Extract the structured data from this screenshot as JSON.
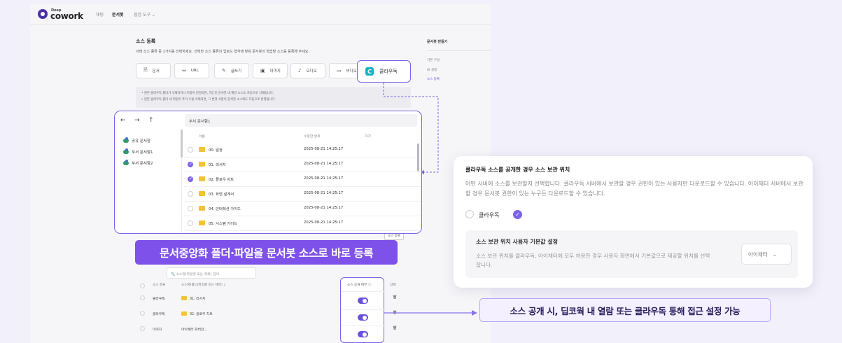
{
  "header": {
    "logo_small": "Deep",
    "logo_big": "cowork",
    "nav": [
      "채팅",
      "문서봇",
      "협업 도구 ⌄"
    ]
  },
  "main": {
    "title": "소스 등록",
    "description": "아래 소스 종류 중 1가지를 선택하세요. 선택한 소스 종류의 업로드 형식에 맞춰 문서봇의 학습할 소스를 등록해 주세요.",
    "source_types": [
      {
        "icon": "🗎",
        "label": "문서"
      },
      {
        "icon": "⇔",
        "label": "URL"
      },
      {
        "icon": "✎",
        "label": "글쓰기"
      },
      {
        "icon": "▣",
        "label": "이미지"
      },
      {
        "icon": "♪",
        "label": "오디오"
      },
      {
        "icon": "▭",
        "label": "비디오"
      }
    ],
    "notes": [
      "• 원본 클라우독 폴더가 삭제되거나 이름이 변경되면, 7일 후 문서봇 내 해당 소스도 자동으로 삭제됩니다.",
      "• 원본 클라우독 폴더 내 파일이 추가·수정·삭제되면, 그 변경 사항이 문서봇 소스에도 자동으로 반영됩니다."
    ]
  },
  "right_panel": {
    "title": "문서봇 만들기",
    "items": [
      "기본 구성",
      "AI 설정",
      "소스 등록"
    ]
  },
  "clipper_callout": {
    "logo_letter": "C",
    "label": "클라우독"
  },
  "file_picker": {
    "path": "부서 문서함1",
    "sidebar": [
      "공유 문서함",
      "부서 문서함1",
      "부서 문서함2"
    ],
    "columns": [
      "이름",
      "수정한 날짜",
      "크기"
    ],
    "rows": [
      {
        "name": "00. 일정",
        "date": "2025-08-21 14:25:17",
        "checked": false
      },
      {
        "name": "01. 리서치",
        "date": "2025-08-21 14:25:17",
        "checked": true
      },
      {
        "name": "02. 플로우 차트",
        "date": "2025-08-21 14:25:17",
        "checked": true
      },
      {
        "name": "03. 화면 설계서",
        "date": "2025-08-21 14:25:17",
        "checked": false
      },
      {
        "name": "04. 인터렉션 가이드",
        "date": "2025-08-21 14:25:17",
        "checked": false
      },
      {
        "name": "05. 시스템 가이드",
        "date": "2025-08-21 14:25:17",
        "checked": false
      }
    ]
  },
  "banner_text": "문서중앙화 폴더·파일을 문서봇 소스로 바로 등록",
  "source_register_button": "소스 등록",
  "source_table": {
    "search_placeholder": "소스명(파일명 또는 제목) 검색",
    "columns": [
      "소스 종류",
      "소스명(폴더/파일명 또는 제목) ↓",
      "소스 공개 여부 ⓘ",
      "삭제"
    ],
    "rows": [
      {
        "type": "클라우독",
        "name": "01. 리서치",
        "folder": true,
        "public": true,
        "delete": "🗑"
      },
      {
        "type": "클라우독",
        "name": "02. 플로우 차트",
        "folder": true,
        "public": true,
        "delete": "🗑"
      },
      {
        "type": "이미지",
        "name": "아이채터 화버전...",
        "folder": false,
        "public": true,
        "delete": "🗑"
      }
    ]
  },
  "settings_card": {
    "title": "클라우독 소스를 공개한 경우 소스 보관 위치",
    "description": "어떤 서버에 소스를 보관할지 선택합니다. 클라우독 서버에서 보관할 경우 권한이 있는 사용자만 다운로드할 수 있습니다. 아이채터 서버에서 보관할 경우 문서봇 권한이 있는 누구든 다운로드할 수 있습니다.",
    "radio_label": "클라우독",
    "sub_title": "소스 보관 위치 사용자 기본값 설정",
    "sub_description": "소스 보관 위치를 클라우독, 아이채터에 모두 허용한 경우 사용자 화면에서 기본값으로 제공할 위치를 선택합니다.",
    "select_value": "아이채터",
    "select_icon": "⌄"
  },
  "bottom_label": "소스 공개 시, 딥코웍 내 열람 또는 클라우독 통해 접근 설정 가능",
  "colors": {
    "accent": "#7d63e8",
    "banner": "#7d51ea",
    "folder": "#f3c23c"
  }
}
